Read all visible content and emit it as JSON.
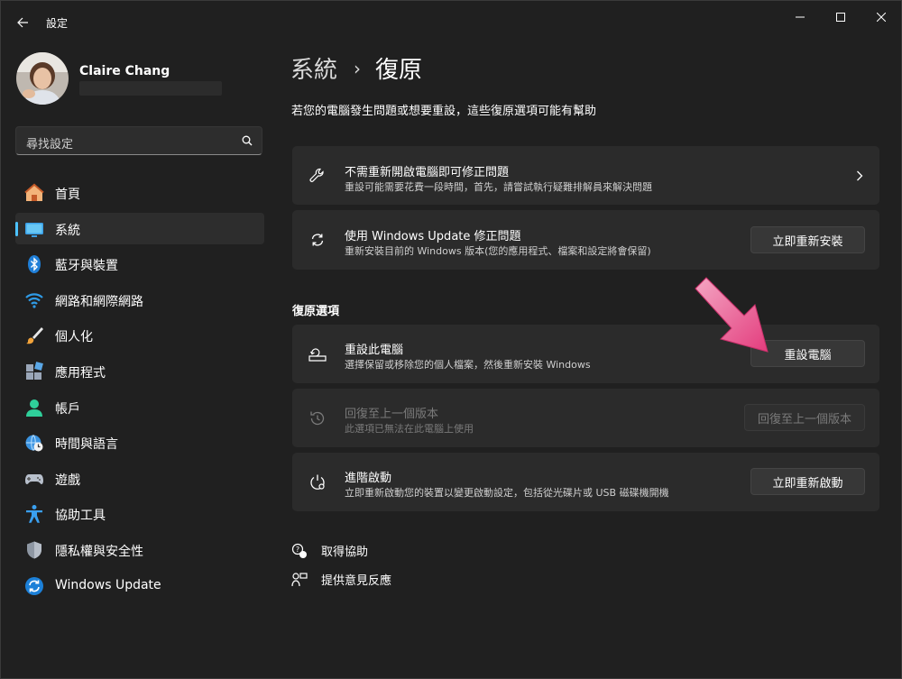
{
  "app": {
    "title": "設定"
  },
  "profile": {
    "name": "Claire Chang"
  },
  "search": {
    "placeholder": "尋找設定"
  },
  "nav": {
    "items": [
      {
        "label": "首頁",
        "icon": "home-icon"
      },
      {
        "label": "系統",
        "icon": "system-icon",
        "active": true
      },
      {
        "label": "藍牙與裝置",
        "icon": "bluetooth-icon"
      },
      {
        "label": "網路和網際網路",
        "icon": "wifi-icon"
      },
      {
        "label": "個人化",
        "icon": "brush-icon"
      },
      {
        "label": "應用程式",
        "icon": "apps-icon"
      },
      {
        "label": "帳戶",
        "icon": "account-icon"
      },
      {
        "label": "時間與語言",
        "icon": "globe-clock-icon"
      },
      {
        "label": "遊戲",
        "icon": "gamepad-icon"
      },
      {
        "label": "協助工具",
        "icon": "accessibility-icon"
      },
      {
        "label": "隱私權與安全性",
        "icon": "shield-icon"
      },
      {
        "label": "Windows Update",
        "icon": "update-icon"
      }
    ]
  },
  "main": {
    "breadcrumb_parent": "系統",
    "breadcrumb_sep": "›",
    "breadcrumb_current": "復原",
    "description": "若您的電腦發生問題或想要重設，這些復原選項可能有幫助",
    "cards": [
      {
        "title": "不需重新開啟電腦即可修正問題",
        "subtitle": "重設可能需要花費一段時間，首先，請嘗試執行疑難排解員來解決問題",
        "icon": "wrench-icon"
      },
      {
        "title": "使用 Windows Update 修正問題",
        "subtitle": "重新安裝目前的 Windows 版本(您的應用程式、檔案和設定將會保留)",
        "button": "立即重新安裝",
        "icon": "refresh-icon"
      }
    ],
    "section_title": "復原選項",
    "recovery": [
      {
        "title": "重設此電腦",
        "subtitle": "選擇保留或移除您的個人檔案，然後重新安裝 Windows",
        "button": "重設電腦",
        "icon": "reset-pc-icon"
      },
      {
        "title": "回復至上一個版本",
        "subtitle": "此選項已無法在此電腦上使用",
        "button": "回復至上一個版本",
        "disabled": true,
        "icon": "history-icon"
      },
      {
        "title": "進階啟動",
        "subtitle": "立即重新啟動您的裝置以變更啟動設定，包括從光碟片或 USB 磁碟機開機",
        "button": "立即重新啟動",
        "icon": "advanced-startup-icon"
      }
    ],
    "links": [
      {
        "label": "取得協助",
        "icon": "help-icon"
      },
      {
        "label": "提供意見反應",
        "icon": "feedback-icon"
      }
    ]
  },
  "colors": {
    "background": "#202020",
    "card": "#2b2b2b",
    "accent": "#4cc2ff",
    "annotation_arrow": "#e5457f"
  }
}
